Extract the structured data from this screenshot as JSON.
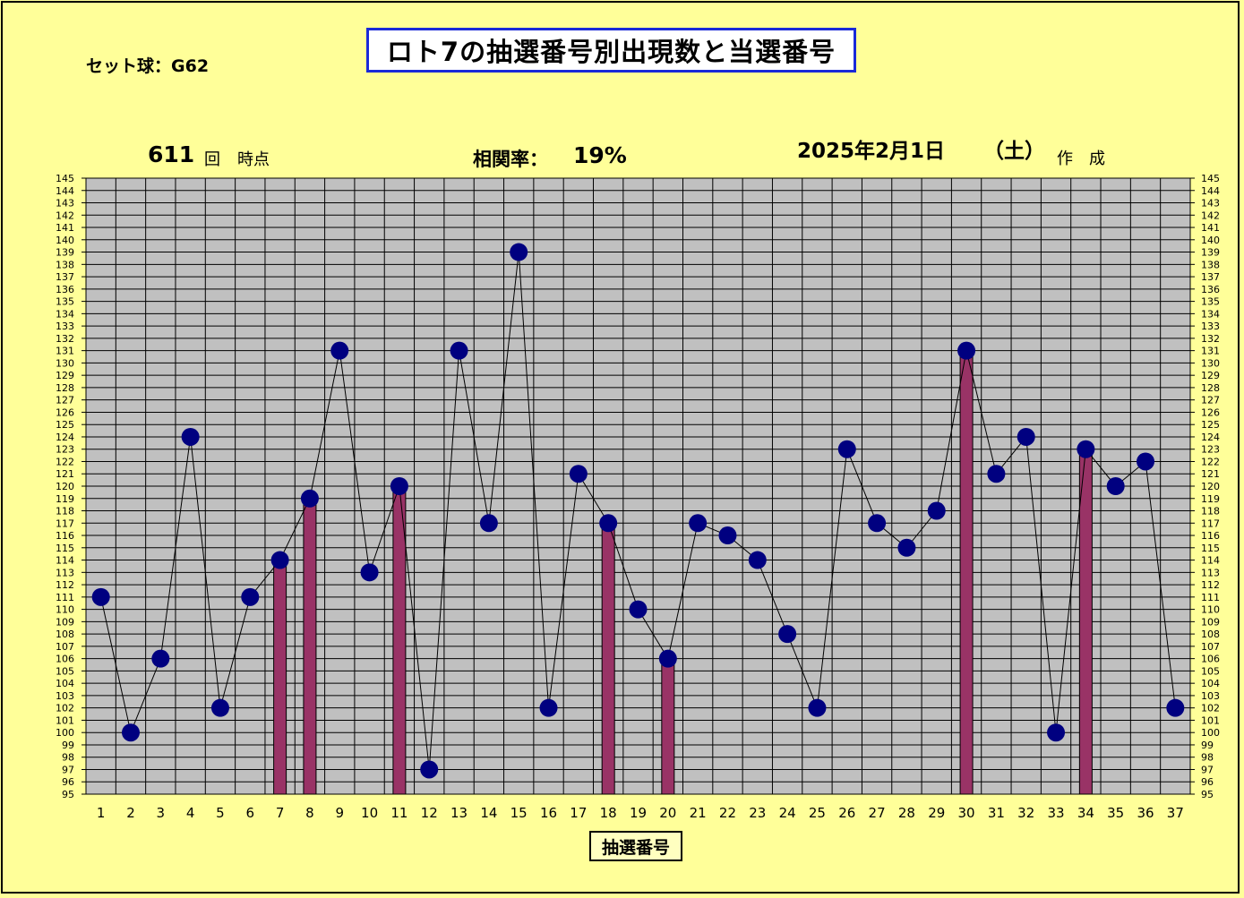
{
  "title": "ロト7の抽選番号別出現数と当選番号",
  "set_ball": "セット球：G62",
  "draw_count": "611",
  "draw_unit_1": "回",
  "draw_unit_2": "時点",
  "correlation_label": "相関率：",
  "correlation_value": "19%",
  "date": "2025年2月1日",
  "weekday": "（土）",
  "made_1": "作",
  "made_2": "成",
  "colors": {
    "background": "#ffff99",
    "plot_area": "#c0c0c0",
    "bar": "#993366",
    "marker": "#000080",
    "title_border": "#1a2ad8"
  },
  "chart_data": {
    "type": "bar",
    "xlabel": "抽選番号",
    "ylim": [
      95,
      145
    ],
    "categories": [
      1,
      2,
      3,
      4,
      5,
      6,
      7,
      8,
      9,
      10,
      11,
      12,
      13,
      14,
      15,
      16,
      17,
      18,
      19,
      20,
      21,
      22,
      23,
      24,
      25,
      26,
      27,
      28,
      29,
      30,
      31,
      32,
      33,
      34,
      35,
      36,
      37
    ],
    "series": [
      {
        "type": "line-markers",
        "values": [
          111,
          100,
          106,
          124,
          102,
          111,
          114,
          119,
          131,
          113,
          120,
          97,
          131,
          117,
          139,
          102,
          121,
          117,
          110,
          106,
          117,
          116,
          114,
          108,
          102,
          123,
          117,
          115,
          118,
          131,
          121,
          124,
          100,
          123,
          120,
          122,
          102
        ]
      },
      {
        "type": "bar",
        "numbers": [
          7,
          8,
          11,
          18,
          20,
          30,
          34
        ],
        "values": [
          114,
          119,
          120,
          117,
          106,
          131,
          123
        ]
      }
    ],
    "grid": true,
    "y_axis_both_sides": true
  }
}
